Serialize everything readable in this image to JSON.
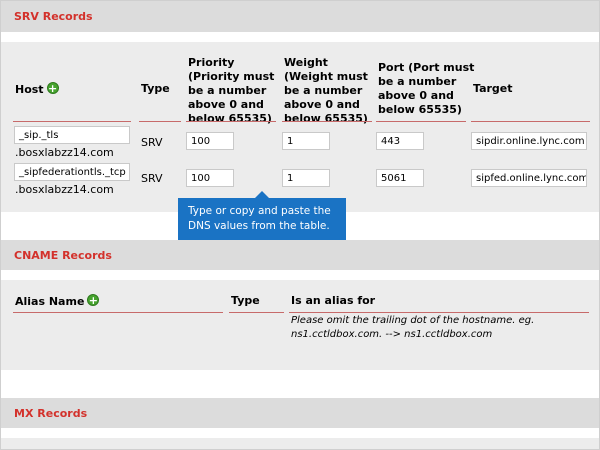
{
  "srv": {
    "title": "SRV Records",
    "columns": {
      "host": "Host",
      "type": "Type",
      "priority": [
        "Priority",
        "(Priority must",
        "be a number",
        "above 0 and",
        "below 65535)"
      ],
      "weight": [
        "Weight",
        "(Weight must",
        "be a number",
        "above 0 and",
        "below 65535)"
      ],
      "port": [
        "Port (Port must",
        "be a number",
        "above 0 and",
        "below 65535)"
      ],
      "target": "Target"
    },
    "rows": [
      {
        "host": "_sip._tls",
        "domain": ".bosxlabzz14.com",
        "type": "SRV",
        "priority": "100",
        "weight": "1",
        "port": "443",
        "target": "sipdir.online.lync.com"
      },
      {
        "host": "_sipfederationtls._tcp",
        "domain": ".bosxlabzz14.com",
        "type": "SRV",
        "priority": "100",
        "weight": "1",
        "port": "5061",
        "target": "sipfed.online.lync.com"
      }
    ]
  },
  "tooltip": {
    "text": "Type or copy and paste the DNS values from the table."
  },
  "cname": {
    "title": "CNAME Records",
    "columns": {
      "alias": "Alias Name",
      "type": "Type",
      "is_alias_for": "Is an alias for"
    },
    "note": "Please omit the trailing dot of the hostname. eg. ns1.cctldbox.com. --> ns1.cctldbox.com"
  },
  "mx": {
    "title": "MX Records"
  },
  "colors": {
    "section_title": "#d3312b",
    "tooltip_bg": "#1a73c4",
    "add_icon": "#46a32e"
  },
  "icons": {
    "add": "plus-circle-icon"
  },
  "add_symbol": "+"
}
